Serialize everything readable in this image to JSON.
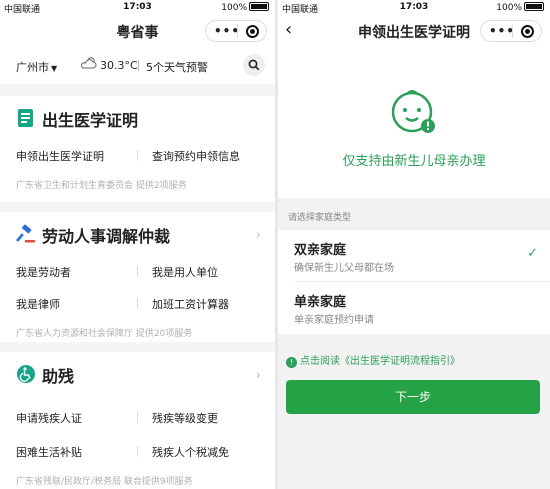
{
  "status": {
    "carrier": "中国联通",
    "time": "17:03",
    "battery": "100%"
  },
  "left": {
    "title": "粤省事",
    "capsule_dots": "•••",
    "city": "广州市",
    "temperature": "30.3°C",
    "weather_alert": "5个天气预警",
    "cards": [
      {
        "title": "出生医学证明",
        "items": [
          "申领出生医学证明",
          "查询预约申领信息"
        ],
        "footnote": "广东省卫生和计划生育委员会 提供2项服务"
      },
      {
        "title": "劳动人事调解仲裁",
        "items": [
          "我是劳动者",
          "我是用人单位",
          "我是律师",
          "加班工资计算器"
        ],
        "footnote": "广东省人力资源和社会保障厅 提供20项服务"
      },
      {
        "title": "助残",
        "items": [
          "申请残疾人证",
          "残疾等级变更",
          "困难生活补贴",
          "残疾人个税减免"
        ],
        "footnote": "广东省残联/民政厅/税务局 联合提供9项服务"
      }
    ]
  },
  "right": {
    "title": "申领出生医学证明",
    "support_text": "仅支持由新生儿母亲办理",
    "section_label": "请选择家庭类型",
    "options": [
      {
        "title": "双亲家庭",
        "desc": "确保新生儿父母都在场",
        "selected": true
      },
      {
        "title": "单亲家庭",
        "desc": "单亲家庭预约申请",
        "selected": false
      }
    ],
    "guide_link": "点击阅读《出生医学证明流程指引》",
    "next_button": "下一步"
  },
  "colors": {
    "brand_green": "#25a245",
    "accent_green": "#2aa05a",
    "icon_teal": "#17a589",
    "icon_blue": "#2c6fd6"
  }
}
